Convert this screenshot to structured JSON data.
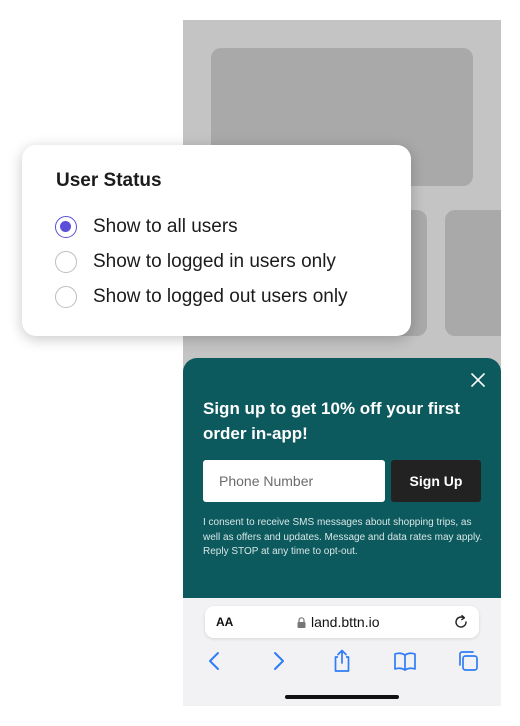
{
  "user_status": {
    "title": "User Status",
    "options": [
      {
        "label": "Show to all users",
        "selected": true
      },
      {
        "label": "Show to logged in users only",
        "selected": false
      },
      {
        "label": "Show to logged out users only",
        "selected": false
      }
    ]
  },
  "popup": {
    "title": "Sign up to get 10% off your first order in-app!",
    "phone_placeholder": "Phone Number",
    "signup_label": "Sign Up",
    "consent": "I consent to receive SMS messages about shopping trips, as well as offers and updates. Message and data rates may apply. Reply STOP at any time to opt-out."
  },
  "browser": {
    "aa_label": "AA",
    "url": "land.bttn.io"
  },
  "colors": {
    "popup_bg": "#0d5a5e",
    "radio_accent": "#5a4fd6",
    "signup_bg": "#222222"
  }
}
